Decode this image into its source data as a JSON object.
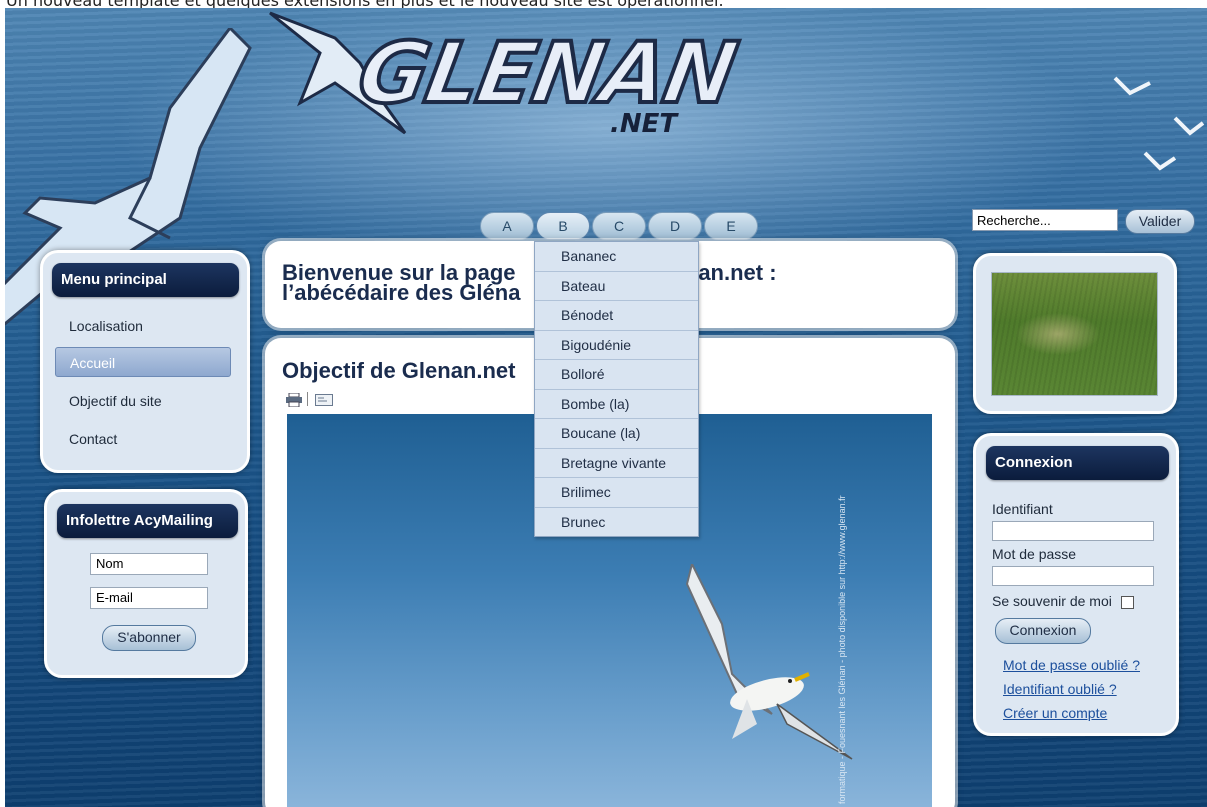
{
  "caption": "Un nouveau template et quelques extensions en plus et le nouveau site est opérationnel.",
  "logo": {
    "main": "GLENAN",
    "suffix": ".NET"
  },
  "alpha_tabs": [
    "A",
    "B",
    "C",
    "D",
    "E"
  ],
  "active_tab": "B",
  "dropdown_items": [
    "Bananec",
    "Bateau",
    "Bénodet",
    "Bigoudénie",
    "Bolloré",
    "Bombe (la)",
    "Boucane (la)",
    "Bretagne vivante",
    "Brilimec",
    "Brunec"
  ],
  "search": {
    "value": "Recherche...",
    "button": "Valider"
  },
  "main_menu": {
    "title": "Menu principal",
    "items": [
      "Localisation",
      "Accueil",
      "Objectif du site",
      "Contact"
    ],
    "active": "Accueil"
  },
  "newsletter": {
    "title": "Infolettre AcyMailing",
    "name_value": "Nom",
    "email_value": "E-mail",
    "button": "S'abonner"
  },
  "welcome": {
    "line1_left": "Bienvenue sur la page",
    "line1_right": "lenan.net :",
    "line2": "l’abécédaire des Gléna"
  },
  "article": {
    "title": "Objectif de Glenan.net",
    "photo_credit": "formatique - Fouesnant les Glénan - photo disponible sur http://www.glenan.fr"
  },
  "login": {
    "title": "Connexion",
    "username_label": "Identifiant",
    "password_label": "Mot de passe",
    "remember_label": "Se souvenir de moi",
    "button": "Connexion",
    "links": [
      "Mot de passe oublié ?",
      "Identifiant oublié ?",
      "Créer un compte"
    ]
  },
  "icons": {
    "print": "print-icon",
    "email": "email-icon"
  }
}
